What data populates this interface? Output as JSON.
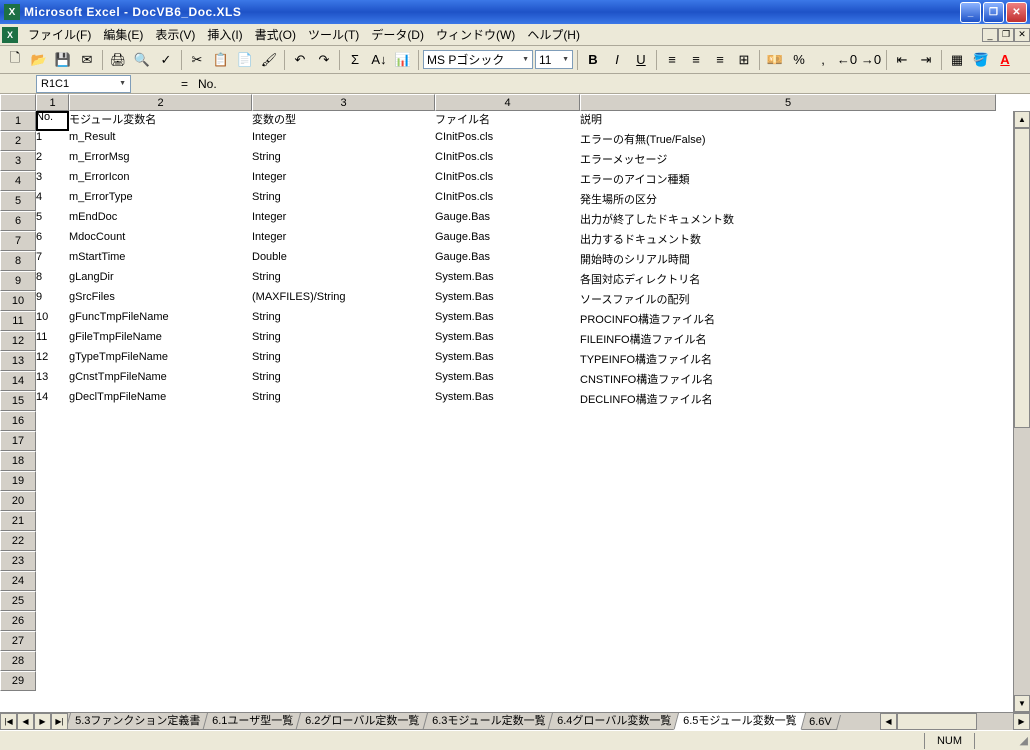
{
  "titlebar": {
    "app_icon": "X",
    "title": "Microsoft Excel - DocVB6_Doc.XLS"
  },
  "menu": {
    "file": "ファイル(F)",
    "edit": "編集(E)",
    "view": "表示(V)",
    "insert": "挿入(I)",
    "format": "書式(O)",
    "tools": "ツール(T)",
    "data": "データ(D)",
    "window": "ウィンドウ(W)",
    "help": "ヘルプ(H)"
  },
  "toolbar": {
    "new": "🗋",
    "open": "📂",
    "save": "💾",
    "mail": "✉",
    "print": "🖨",
    "preview": "🔍",
    "spell": "✓",
    "cut": "✂",
    "copy": "📋",
    "paste": "📄",
    "format_painter": "🖌",
    "undo": "↶",
    "redo": "↷",
    "autosum": "Σ",
    "sort": "A↓",
    "chart": "📊",
    "font_name": "MS Pゴシック",
    "font_size": "11",
    "bold": "B",
    "italic": "I",
    "underline": "U",
    "align_left": "≡",
    "align_center": "≡",
    "align_right": "≡",
    "merge": "⊞",
    "currency": "💴",
    "percent": "%",
    "comma": ",",
    "inc_dec": "←0",
    "dec_dec": "→0",
    "indent_out": "⇤",
    "indent_in": "⇥",
    "borders": "▦",
    "fill": "🪣",
    "font_color": "A"
  },
  "formula_bar": {
    "name_box": "R1C1",
    "eq": "=",
    "content": "No."
  },
  "columns": [
    "1",
    "2",
    "3",
    "4",
    "5"
  ],
  "table_headers": {
    "no": "No.",
    "name": "モジュール変数名",
    "type": "変数の型",
    "file": "ファイル名",
    "desc": "説明"
  },
  "rows": [
    {
      "no": "1",
      "name": "m_Result",
      "type": "Integer",
      "file": "CInitPos.cls",
      "desc": "エラーの有無(True/False)"
    },
    {
      "no": "2",
      "name": "m_ErrorMsg",
      "type": "String",
      "file": "CInitPos.cls",
      "desc": "エラーメッセージ"
    },
    {
      "no": "3",
      "name": "m_ErrorIcon",
      "type": "Integer",
      "file": "CInitPos.cls",
      "desc": "エラーのアイコン種類"
    },
    {
      "no": "4",
      "name": "m_ErrorType",
      "type": "String",
      "file": "CInitPos.cls",
      "desc": "発生場所の区分"
    },
    {
      "no": "5",
      "name": "mEndDoc",
      "type": "Integer",
      "file": "Gauge.Bas",
      "desc": "出力が終了したドキュメント数"
    },
    {
      "no": "6",
      "name": "MdocCount",
      "type": "Integer",
      "file": "Gauge.Bas",
      "desc": "出力するドキュメント数"
    },
    {
      "no": "7",
      "name": "mStartTime",
      "type": "Double",
      "file": "Gauge.Bas",
      "desc": "開始時のシリアル時間"
    },
    {
      "no": "8",
      "name": "gLangDir",
      "type": "String",
      "file": "System.Bas",
      "desc": "各国対応ディレクトリ名"
    },
    {
      "no": "9",
      "name": "gSrcFiles",
      "type": "(MAXFILES)/String",
      "file": "System.Bas",
      "desc": "ソースファイルの配列"
    },
    {
      "no": "10",
      "name": "gFuncTmpFileName",
      "type": "String",
      "file": "System.Bas",
      "desc": "PROCINFO構造ファイル名"
    },
    {
      "no": "11",
      "name": "gFileTmpFileName",
      "type": "String",
      "file": "System.Bas",
      "desc": "FILEINFO構造ファイル名"
    },
    {
      "no": "12",
      "name": "gTypeTmpFileName",
      "type": "String",
      "file": "System.Bas",
      "desc": "TYPEINFO構造ファイル名"
    },
    {
      "no": "13",
      "name": "gCnstTmpFileName",
      "type": "String",
      "file": "System.Bas",
      "desc": "CNSTINFO構造ファイル名"
    },
    {
      "no": "14",
      "name": "gDeclTmpFileName",
      "type": "String",
      "file": "System.Bas",
      "desc": "DECLINFO構造ファイル名"
    }
  ],
  "empty_rows": 14,
  "row_numbers_total": 29,
  "sheet_tabs": [
    {
      "label": "5.3ファンクション定義書",
      "active": false
    },
    {
      "label": "6.1ユーザ型一覧",
      "active": false
    },
    {
      "label": "6.2グローバル定数一覧",
      "active": false
    },
    {
      "label": "6.3モジュール定数一覧",
      "active": false
    },
    {
      "label": "6.4グローバル変数一覧",
      "active": false
    },
    {
      "label": "6.5モジュール変数一覧",
      "active": true
    },
    {
      "label": "6.6V",
      "active": false
    }
  ],
  "status": {
    "num": "NUM"
  }
}
